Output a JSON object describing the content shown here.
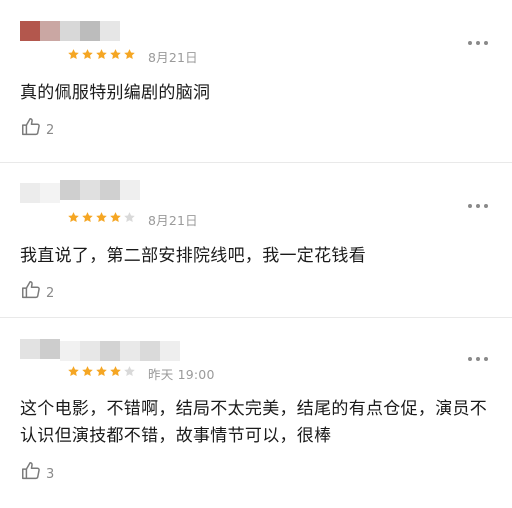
{
  "colors": {
    "star": "#f5a623",
    "star_empty": "#d9d9d9",
    "muted": "#9a9a9a"
  },
  "comments": [
    {
      "rating": 5,
      "time": "8月21日",
      "text": "真的佩服特别编剧的脑洞",
      "likes": "2",
      "icons": {
        "more": "more-dots-icon",
        "like": "thumbs-up-icon"
      }
    },
    {
      "rating": 4,
      "time": "8月21日",
      "text": "我直说了，第二部安排院线吧，我一定花钱看",
      "likes": "2",
      "icons": {
        "more": "more-dots-icon",
        "like": "thumbs-up-icon"
      }
    },
    {
      "rating": 4,
      "time": "昨天 19:00",
      "text": "这个电影，不错啊，结局不太完美，结尾的有点仓促，演员不认识但演技都不错，故事情节可以，很棒",
      "likes": "3",
      "icons": {
        "more": "more-dots-icon",
        "like": "thumbs-up-icon"
      }
    }
  ]
}
